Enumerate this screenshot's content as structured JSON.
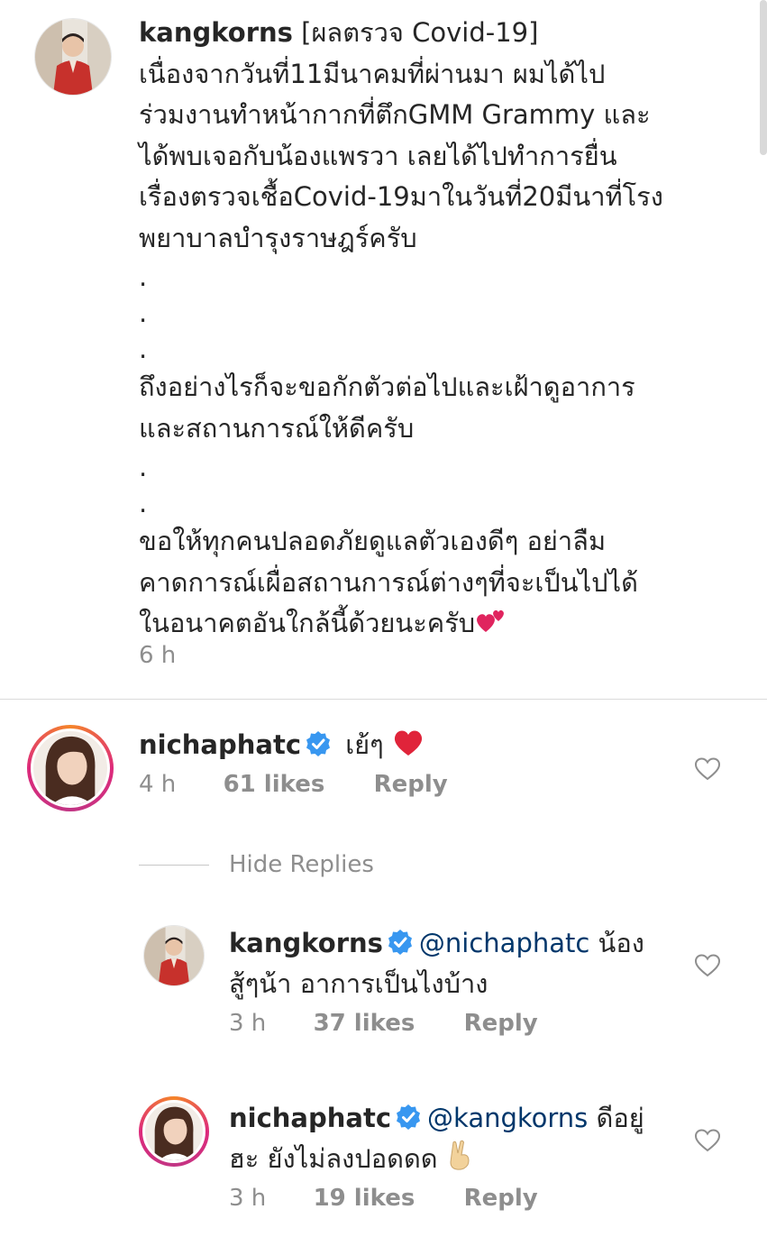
{
  "post": {
    "username": "kangkorns",
    "caption_lines": [
      " [ผลตรวจ Covid-19]",
      "เนื่องจากวันที่11มีนาคมที่ผ่านมา ผมได้ไป",
      "ร่วมงานทำหน้ากากที่ตึกGMM Grammy และ",
      "ได้พบเจอกับน้องแพรวา เลยได้ไปทำการยื่น",
      "เรื่องตรวจเชื้อCovid-19มาในวันที่20มีนาที่โรง",
      "พยาบาลบำรุงราษฎร์ครับ",
      ".",
      ".",
      ".",
      "ถึงอย่างไรก็จะขอกักตัวต่อไปและเฝ้าดูอาการ",
      "และสถานการณ์ให้ดีครับ",
      ".",
      ".",
      "ขอให้ทุกคนปลอดภัยดูแลตัวเองดีๆ อย่าลืม",
      "คาดการณ์เผื่อสถานการณ์ต่างๆที่จะเป็นไปได้",
      "ในอนาคตอันใกล้นี้ด้วยนะครับ"
    ],
    "caption_emoji": "two-hearts",
    "time": "6 h"
  },
  "comments": [
    {
      "username": "nichaphatc",
      "text": " เย้ๆ ",
      "time": "4 h",
      "likes": "61 likes",
      "reply": "Reply"
    }
  ],
  "hide_replies": "Hide Replies",
  "replies": [
    {
      "username": "kangkorns",
      "mention": "@nichaphatc",
      "text_line1": " น้อง",
      "text_line2": "สู้ๆน้า อาการเป็นไงบ้าง",
      "time": "3 h",
      "likes": "37 likes",
      "reply": "Reply"
    },
    {
      "username": "nichaphatc",
      "mention": "@kangkorns",
      "text_line1": " ดีอยู่",
      "text_line2": "ฮะ ยังไม่ลงปอดดด ",
      "time": "3 h",
      "likes": "19 likes",
      "reply": "Reply"
    }
  ],
  "colors": {
    "text": "#262626",
    "meta": "#8e8e8e",
    "mention": "#00376b",
    "verified": "#3897f0",
    "heart_red": "#ed4956",
    "divider": "#dbdbdb"
  }
}
